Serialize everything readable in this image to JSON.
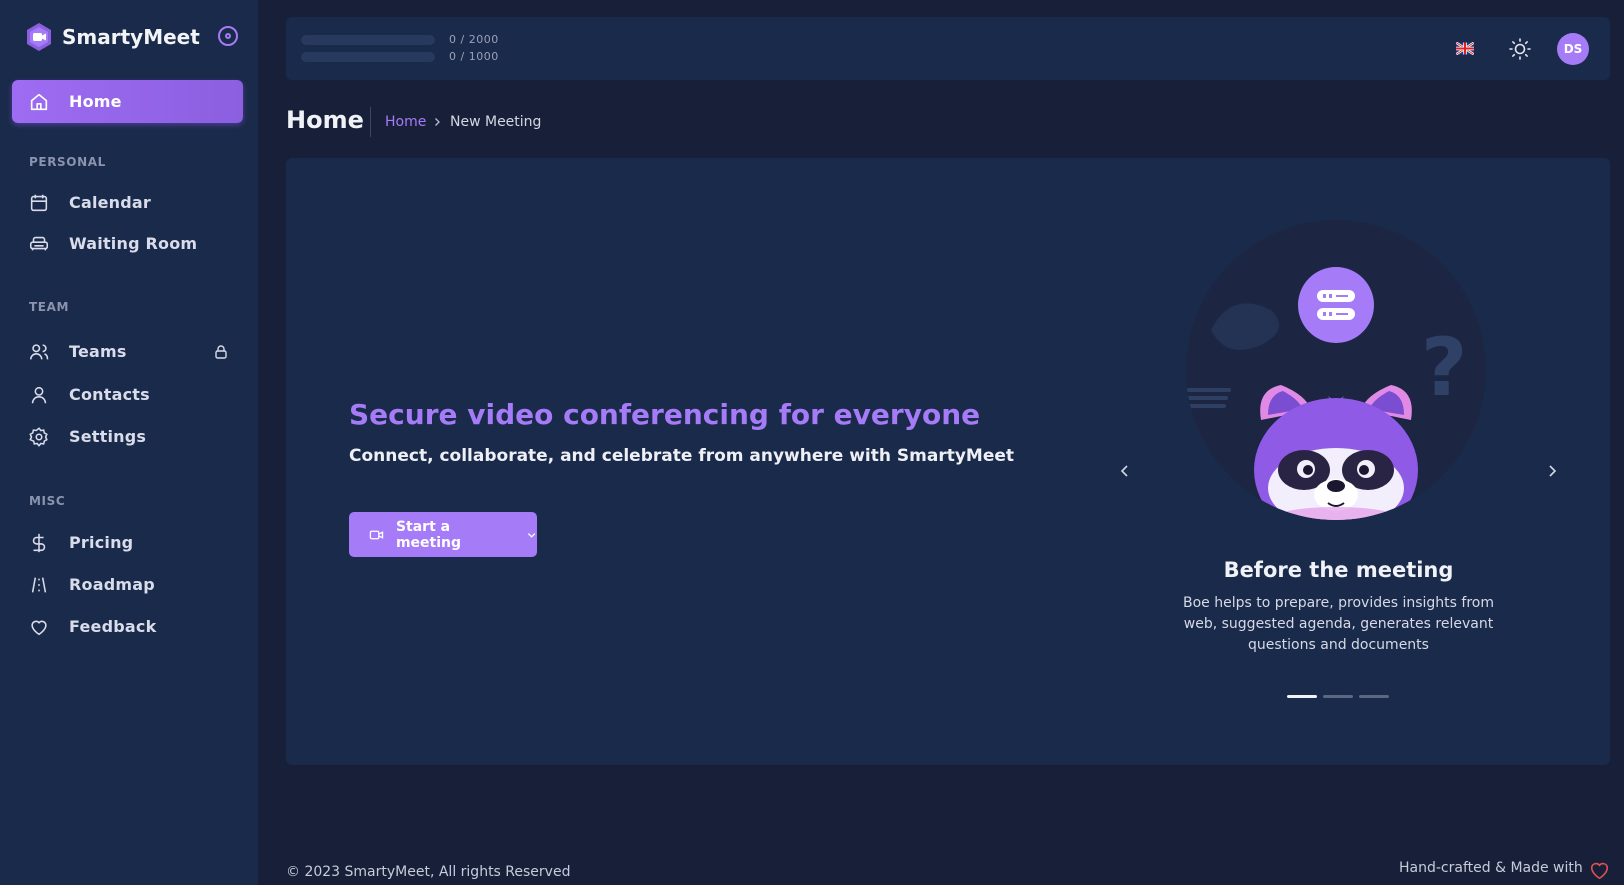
{
  "app": {
    "name": "SmartyMeet"
  },
  "sidebar": {
    "home_label": "Home",
    "sections": {
      "personal": "PERSONAL",
      "team": "TEAM",
      "misc": "MISC"
    },
    "items": {
      "calendar": "Calendar",
      "waiting_room": "Waiting Room",
      "teams": "Teams",
      "contacts": "Contacts",
      "settings": "Settings",
      "pricing": "Pricing",
      "roadmap": "Roadmap",
      "feedback": "Feedback"
    }
  },
  "topbar": {
    "quota_1": {
      "text": "0 / 2000",
      "used": 0
    },
    "quota_2": {
      "text": "0 / 1000",
      "used": 0
    },
    "language_icon": "uk-flag-icon",
    "theme_icon": "sun-icon",
    "avatar_initials": "DS"
  },
  "header": {
    "title": "Home",
    "breadcrumb": {
      "home": "Home",
      "current": "New Meeting"
    }
  },
  "hero": {
    "title": "Secure video conferencing for everyone",
    "subtitle": "Connect, collaborate, and celebrate from anywhere with SmartyMeet",
    "start_button": "Start a meeting"
  },
  "carousel": {
    "slide_title": "Before the meeting",
    "slide_description": "Boe helps to prepare, provides insights from web, suggested agenda, generates relevant questions and documents",
    "slide_count": 3,
    "active_slide": 1
  },
  "footer": {
    "copyright": "© 2023 SmartyMeet, All rights Reserved",
    "credit": "Hand-crafted & Made with"
  },
  "colors": {
    "accent": "#a57bf7",
    "background": "#172038",
    "surface": "#1a2a4a"
  }
}
